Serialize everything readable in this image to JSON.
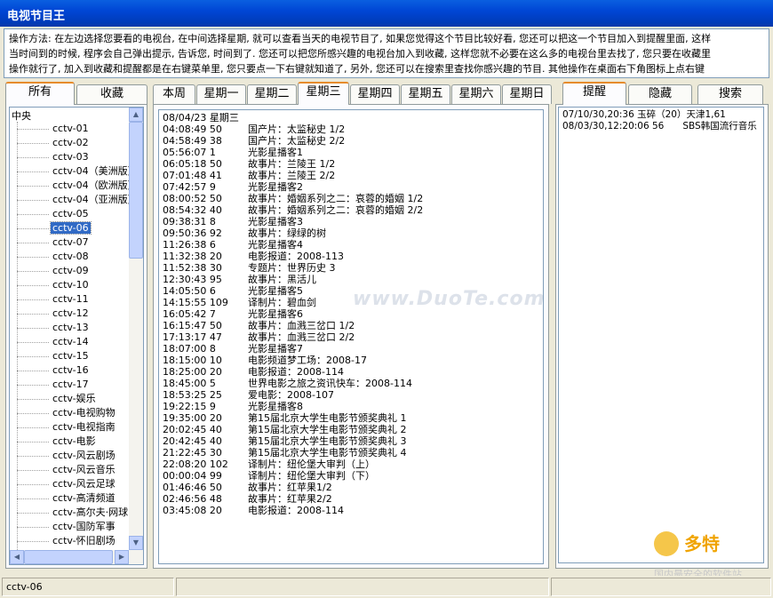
{
  "window": {
    "title": "电视节目王"
  },
  "instructions": [
    "操作方法: 在左边选择您要看的电视台, 在中间选择星期, 就可以查看当天的电视节目了, 如果您觉得这个节目比较好看, 您还可以把这一个节目加入到提醒里面, 这样",
    "当时间到的时候, 程序会自己弹出提示, 告诉您, 时间到了. 您还可以把您所感兴趣的电视台加入到收藏, 这样您就不必要在这么多的电视台里去找了, 您只要在收藏里",
    "操作就行了, 加入到收藏和提醒都是在右键菜单里, 您只要点一下右键就知道了, 另外, 您还可以在搜索里查找你感兴趣的节目. 其他操作在桌面右下角图标上点右键"
  ],
  "left_tabs": [
    "所有",
    "收藏"
  ],
  "tree": {
    "root": "中央",
    "items": [
      "cctv-01",
      "cctv-02",
      "cctv-03",
      "cctv-04（美洲版）",
      "cctv-04（欧洲版）",
      "cctv-04（亚洲版）",
      "cctv-05",
      "cctv-06",
      "cctv-07",
      "cctv-08",
      "cctv-09",
      "cctv-10",
      "cctv-11",
      "cctv-12",
      "cctv-13",
      "cctv-14",
      "cctv-15",
      "cctv-16",
      "cctv-17",
      "cctv-娱乐",
      "cctv-电视购物",
      "cctv-电视指南",
      "cctv-电影",
      "cctv-风云剧场",
      "cctv-风云音乐",
      "cctv-风云足球",
      "cctv-高清频道",
      "cctv-高尔夫·网球",
      "cctv-国防军事",
      "cctv-怀旧剧场"
    ],
    "selected": "cctv-06"
  },
  "day_tabs": [
    "本周",
    "星期一",
    "星期二",
    "星期三",
    "星期四",
    "星期五",
    "星期六",
    "星期日"
  ],
  "active_day": "星期三",
  "schedule": {
    "header": "08/04/23 星期三",
    "rows": [
      [
        "04:08:49 50",
        "国产片：太监秘史 1/2"
      ],
      [
        "04:58:49 38",
        "国产片：太监秘史 2/2"
      ],
      [
        "05:56:07 1",
        "光影星播客1"
      ],
      [
        "06:05:18 50",
        "故事片：兰陵王 1/2"
      ],
      [
        "07:01:48 41",
        "故事片：兰陵王 2/2"
      ],
      [
        "07:42:57 9",
        "光影星播客2"
      ],
      [
        "08:00:52 50",
        "故事片：婚姻系列之二：哀蓉的婚姻 1/2"
      ],
      [
        "08:54:32 40",
        "故事片：婚姻系列之二：哀蓉的婚姻 2/2"
      ],
      [
        "09:38:31 8",
        "光影星播客3"
      ],
      [
        "09:50:36 92",
        "故事片：绿绿的树"
      ],
      [
        "11:26:38 6",
        "光影星播客4"
      ],
      [
        "11:32:38 20",
        "电影报道：2008-113"
      ],
      [
        "11:52:38 30",
        "专题片：世界历史 3"
      ],
      [
        "12:30:43 95",
        "故事片：黑活儿"
      ],
      [
        "14:05:50 6",
        "光影星播客5"
      ],
      [
        "14:15:55 109",
        "译制片：碧血剑"
      ],
      [
        "16:05:42 7",
        "光影星播客6"
      ],
      [
        "16:15:47 50",
        "故事片：血溅三岔口 1/2"
      ],
      [
        "17:13:17 47",
        "故事片：血溅三岔口 2/2"
      ],
      [
        "18:07:00 8",
        "光影星播客7"
      ],
      [
        "18:15:00 10",
        "电影频道梦工场：2008-17"
      ],
      [
        "18:25:00 20",
        "电影报道：2008-114"
      ],
      [
        "18:45:00 5",
        "世界电影之旅之资讯快车：2008-114"
      ],
      [
        "18:53:25 25",
        "爱电影：2008-107"
      ],
      [
        "19:22:15 9",
        "光影星播客8"
      ],
      [
        "19:35:00 20",
        "第15届北京大学生电影节颁奖典礼 1"
      ],
      [
        "20:02:45 40",
        "第15届北京大学生电影节颁奖典礼 2"
      ],
      [
        "20:42:45 40",
        "第15届北京大学生电影节颁奖典礼 3"
      ],
      [
        "21:22:45 30",
        "第15届北京大学生电影节颁奖典礼 4"
      ],
      [
        "22:08:20 102",
        "译制片：纽伦堡大审判（上）"
      ],
      [
        "00:00:04 99",
        "译制片：纽伦堡大审判（下）"
      ],
      [
        "01:46:46 50",
        "故事片：红苹果1/2"
      ],
      [
        "02:46:56 48",
        "故事片：红苹果2/2"
      ],
      [
        "03:45:08 20",
        "电影报道：2008-114"
      ]
    ]
  },
  "watermark": "www.DuoTe.com",
  "right_tabs": [
    "提醒",
    "隐藏",
    "搜索"
  ],
  "reminders": [
    "07/10/30,20:36 玉碎（20）天津1,61",
    "08/03/30,12:20:06 56　　SBS韩国流行音乐"
  ],
  "status": {
    "left": "cctv-06",
    "mid": "",
    "right": ""
  },
  "logo": {
    "big": "多特",
    "sub": "国内最安全的软件站"
  }
}
